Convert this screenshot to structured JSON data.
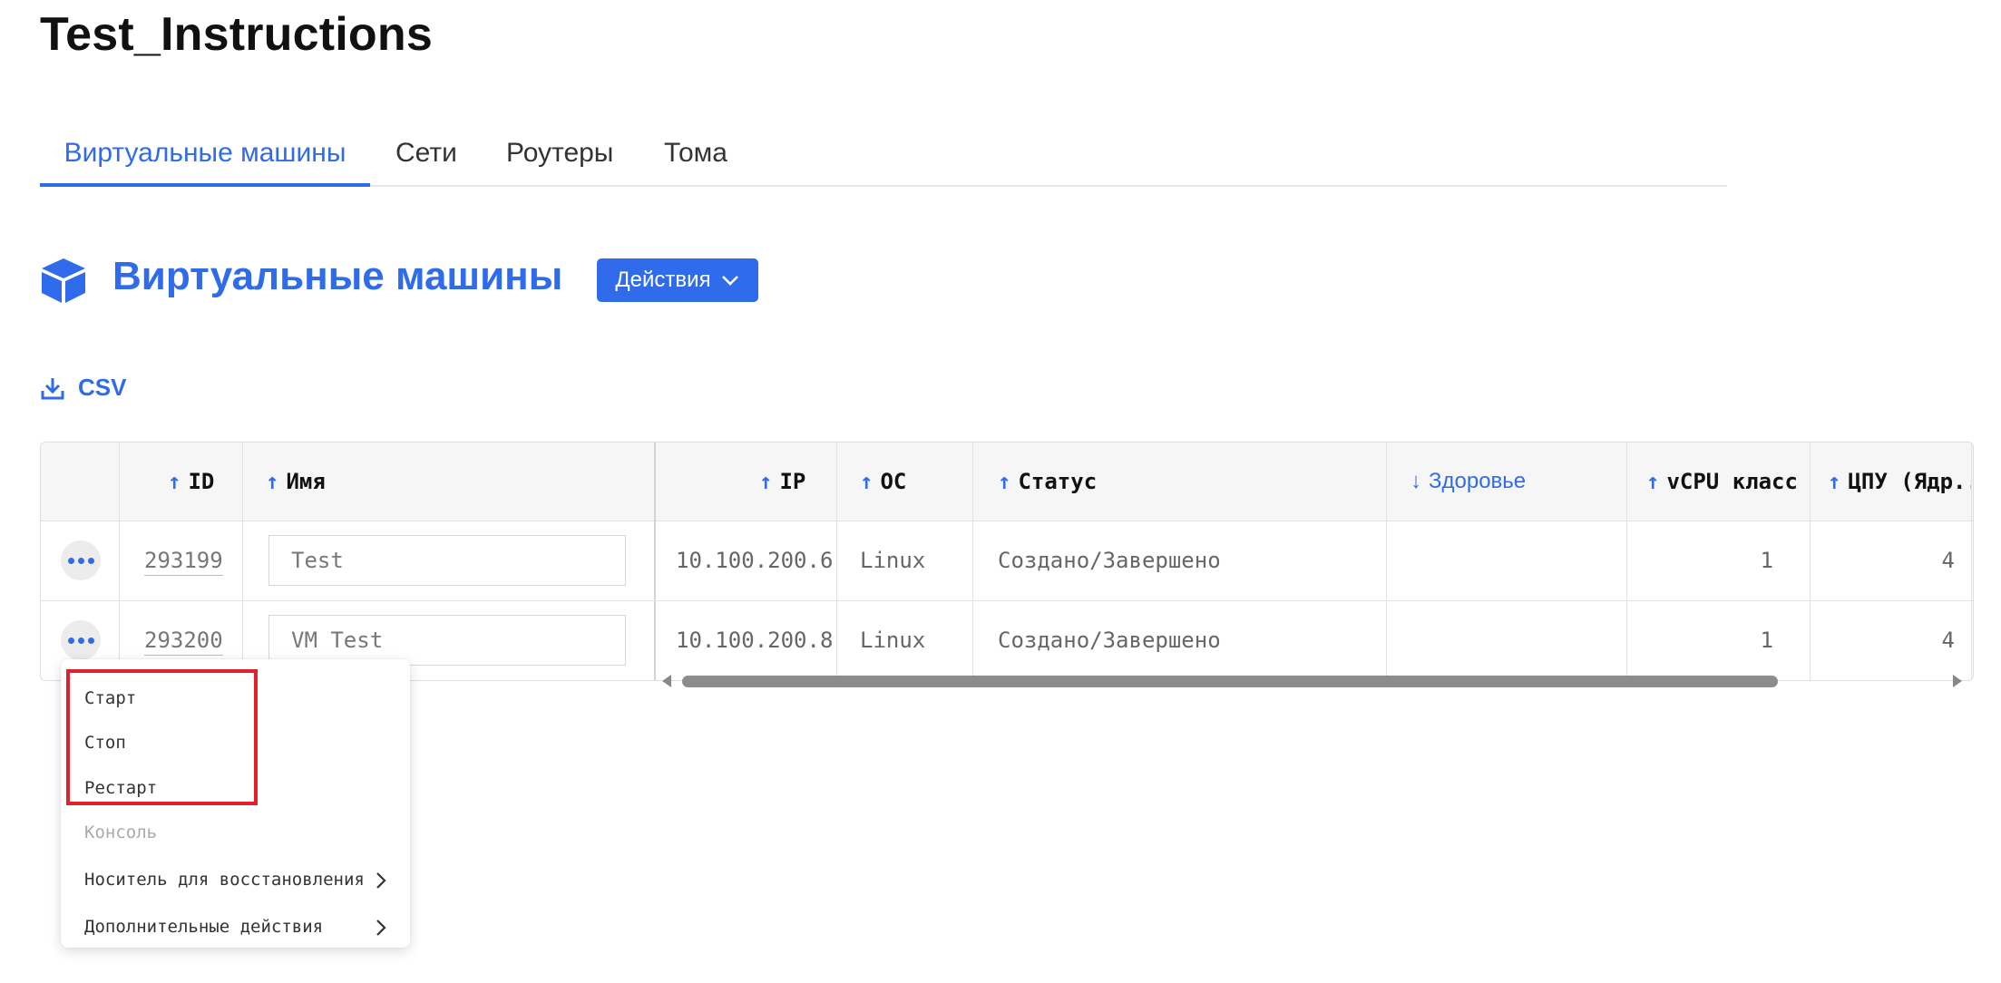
{
  "page": {
    "title": "Test_Instructions"
  },
  "tabs": [
    {
      "label": "Виртуальные машины",
      "active": true
    },
    {
      "label": "Сети",
      "active": false
    },
    {
      "label": "Роутеры",
      "active": false
    },
    {
      "label": "Тома",
      "active": false
    }
  ],
  "section": {
    "title": "Виртуальные машины",
    "icon": "cube-icon",
    "actions_label": "Действия",
    "csv_label": "CSV"
  },
  "table": {
    "columns": [
      {
        "label": "ID",
        "sort": "asc"
      },
      {
        "label": "Имя",
        "sort": "asc"
      },
      {
        "label": "IP",
        "sort": "asc"
      },
      {
        "label": "ОС",
        "sort": "asc"
      },
      {
        "label": "Статус",
        "sort": "asc"
      },
      {
        "label": "Здоровье",
        "sort": "desc"
      },
      {
        "label": "vCPU класс",
        "sort": "asc"
      },
      {
        "label": "ЦПУ (Ядр...",
        "sort": "asc"
      }
    ],
    "rows": [
      {
        "id": "293199",
        "name": "Test",
        "ip": "10.100.200.6",
        "os": "Linux",
        "status": "Создано/Завершено",
        "health": "",
        "vcpu_class": "1",
        "cpu": "4"
      },
      {
        "id": "293200",
        "name": "VM Test",
        "ip": "10.100.200.8",
        "os": "Linux",
        "status": "Создано/Завершено",
        "health": "",
        "vcpu_class": "1",
        "cpu": "4"
      }
    ]
  },
  "context_menu": {
    "items": [
      {
        "label": "Старт",
        "enabled": true
      },
      {
        "label": "Стоп",
        "enabled": true
      },
      {
        "label": "Рестарт",
        "enabled": true
      },
      {
        "label": "Консоль",
        "enabled": false
      },
      {
        "label": "Носитель для восстановления",
        "enabled": true,
        "submenu": true
      },
      {
        "label": "Дополнительные действия",
        "enabled": true,
        "submenu": true
      }
    ]
  },
  "colors": {
    "accent": "#2f6bea",
    "highlight": "#e0202a"
  }
}
